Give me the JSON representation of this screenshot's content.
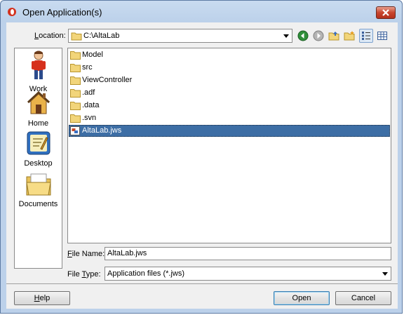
{
  "window": {
    "title": "Open Application(s)"
  },
  "location": {
    "label": "Location:",
    "value": "C:\\AltaLab"
  },
  "toolbar": {
    "icons": [
      "back-icon",
      "forward-icon",
      "up-folder-icon",
      "new-folder-icon",
      "list-view-icon",
      "details-view-icon"
    ]
  },
  "places": [
    {
      "label": "Work",
      "icon": "work-person-icon"
    },
    {
      "label": "Home",
      "icon": "home-icon"
    },
    {
      "label": "Desktop",
      "icon": "desktop-icon"
    },
    {
      "label": "Documents",
      "icon": "documents-icon"
    }
  ],
  "files": [
    {
      "name": "Model",
      "type": "folder"
    },
    {
      "name": "src",
      "type": "folder"
    },
    {
      "name": "ViewController",
      "type": "folder"
    },
    {
      "name": ".adf",
      "type": "folder"
    },
    {
      "name": ".data",
      "type": "folder"
    },
    {
      "name": ".svn",
      "type": "folder"
    },
    {
      "name": "AltaLab.jws",
      "type": "workspace",
      "selected": true
    }
  ],
  "file_name": {
    "label_underlined": "F",
    "label_rest": "ile Name:",
    "value": "AltaLab.jws"
  },
  "file_type": {
    "label_prefix": "File ",
    "label_underlined": "T",
    "label_rest": "ype:",
    "value": "Application files  (*.jws)"
  },
  "buttons": {
    "help_underlined": "H",
    "help_rest": "elp",
    "open": "Open",
    "cancel": "Cancel"
  },
  "colors": {
    "selection": "#3d6ea5",
    "titlebar": "#bcd1ea",
    "close": "#c8452e"
  }
}
